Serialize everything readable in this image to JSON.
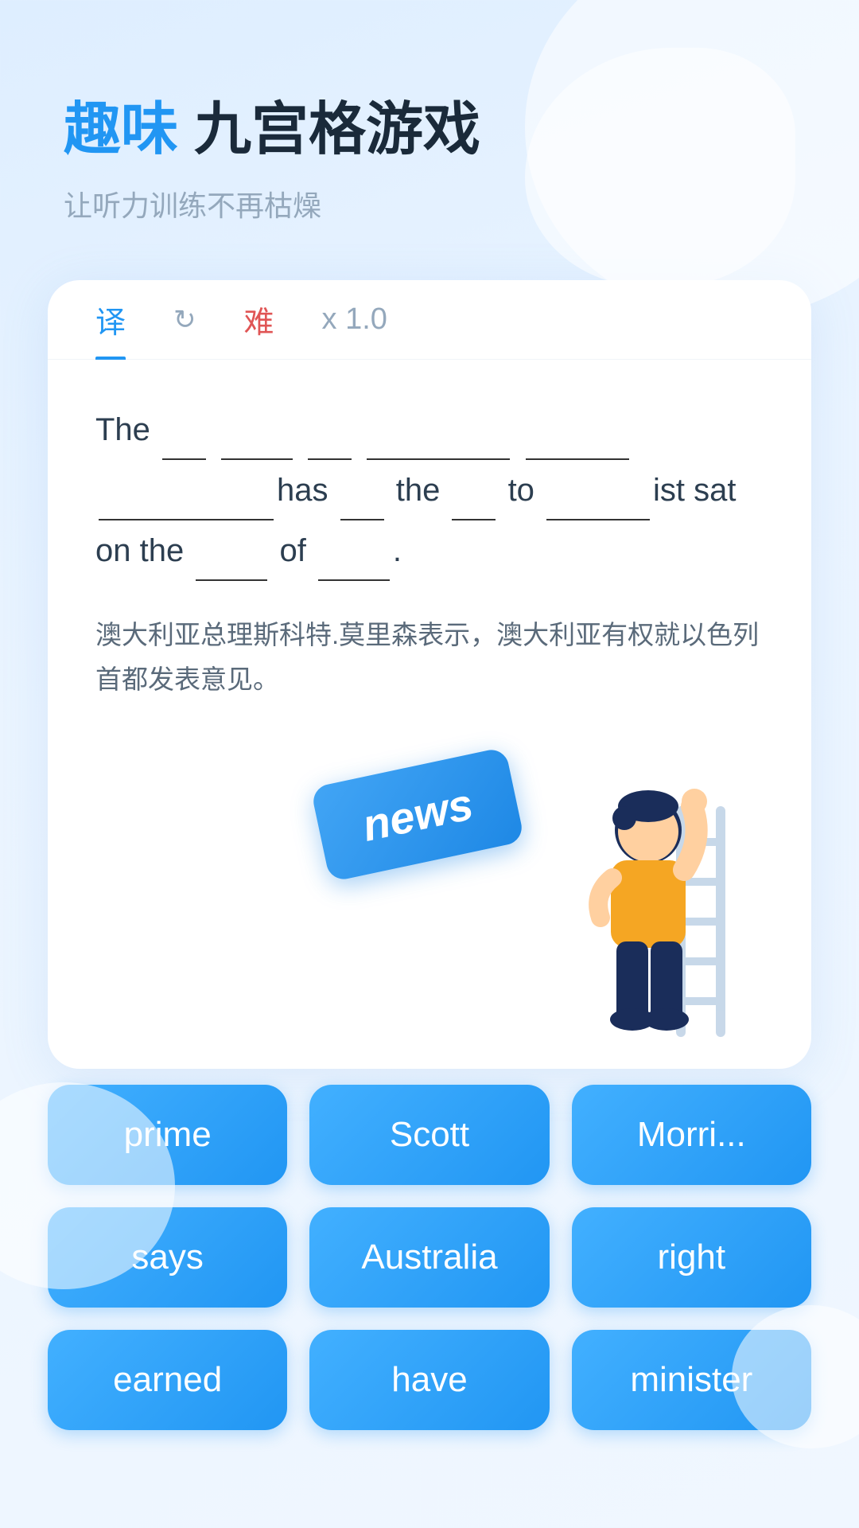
{
  "header": {
    "title_blue": "趣味",
    "title_dark": "九宫格游戏",
    "subtitle": "让听力训练不再枯燥"
  },
  "tabs": [
    {
      "id": "translate",
      "label": "译",
      "active": true
    },
    {
      "id": "refresh",
      "label": "↻",
      "active": false
    },
    {
      "id": "difficulty",
      "label": "难",
      "active": false
    },
    {
      "id": "speed",
      "label": "x 1.0",
      "active": false
    }
  ],
  "sentence": {
    "full_text": "The ___ ______ ___ __________ _____ ________has ___ the ___ to _____ist sat on the ____ of _____.",
    "translation": "澳大利亚总理斯科特.莫里森表示，澳大利亚有权就以色列首都发表意见。"
  },
  "news_card": {
    "label": "news"
  },
  "word_grid": [
    {
      "id": "word-prime",
      "label": "prime"
    },
    {
      "id": "word-scott",
      "label": "Scott"
    },
    {
      "id": "word-morrison",
      "label": "Morri..."
    },
    {
      "id": "word-says",
      "label": "says"
    },
    {
      "id": "word-australia",
      "label": "Australia"
    },
    {
      "id": "word-right",
      "label": "right"
    },
    {
      "id": "word-earned",
      "label": "earned"
    },
    {
      "id": "word-have",
      "label": "have"
    },
    {
      "id": "word-minister",
      "label": "minister"
    }
  ]
}
